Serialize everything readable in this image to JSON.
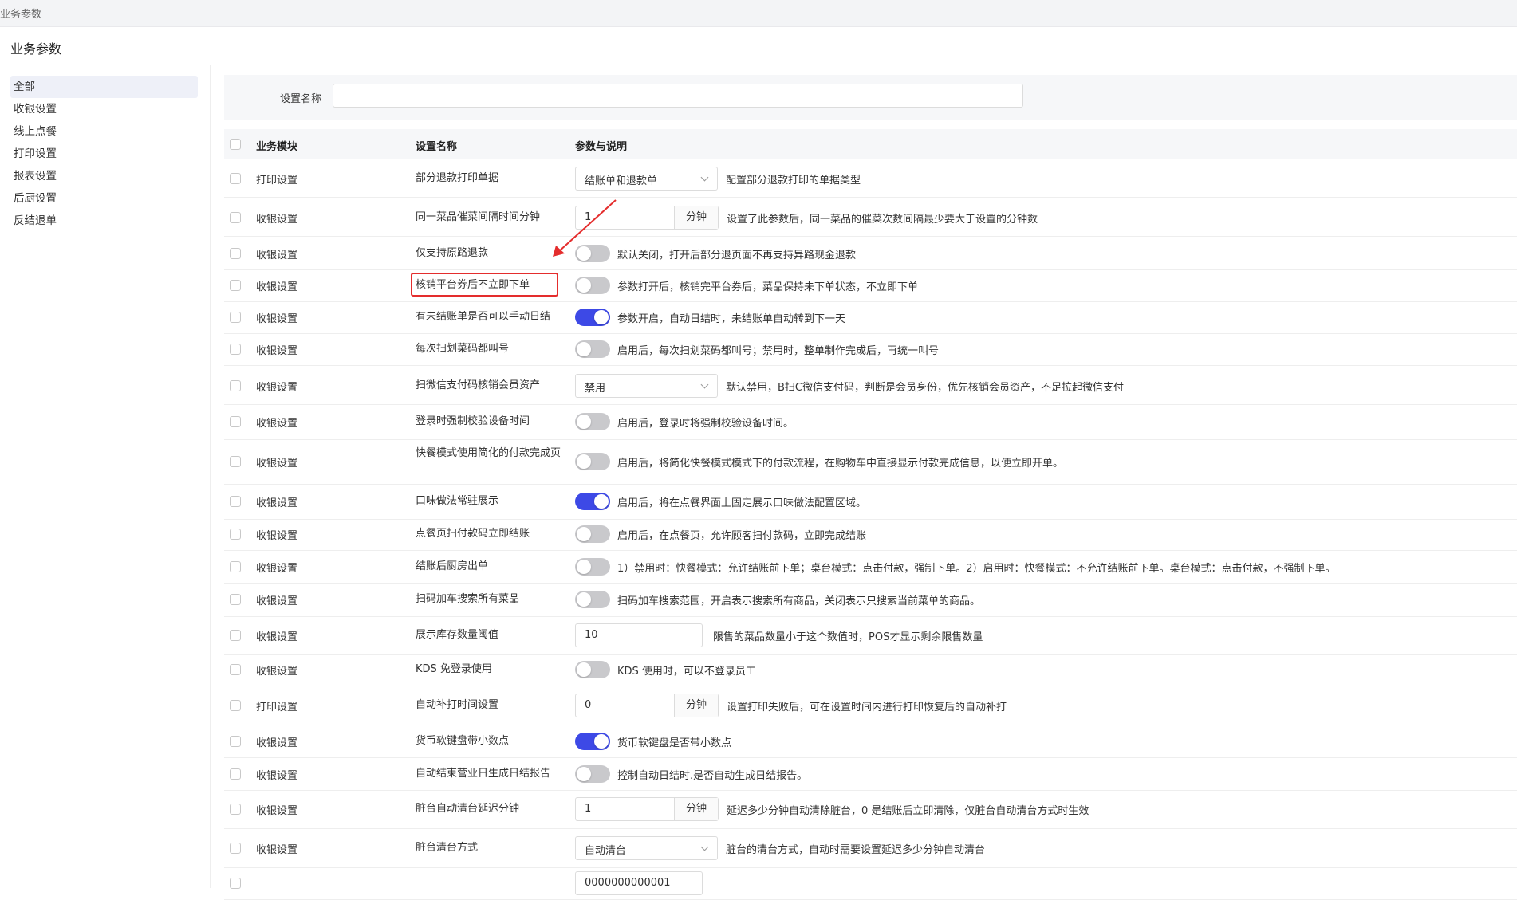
{
  "window": {
    "tab_title": "业务参数"
  },
  "page": {
    "title": "业务参数"
  },
  "sidebar": {
    "items": [
      {
        "label": "全部",
        "active": true
      },
      {
        "label": "收银设置"
      },
      {
        "label": "线上点餐"
      },
      {
        "label": "打印设置"
      },
      {
        "label": "报表设置"
      },
      {
        "label": "后厨设置"
      },
      {
        "label": "反结退单"
      }
    ]
  },
  "filter": {
    "label": "设置名称",
    "value": ""
  },
  "table": {
    "headers": {
      "module": "业务模块",
      "name": "设置名称",
      "param": "参数与说明"
    },
    "rows": [
      {
        "module": "打印设置",
        "name": "部分退款打印单据",
        "control": "select",
        "value": "结账单和退款单",
        "desc": "配置部分退款打印的单据类型"
      },
      {
        "module": "收银设置",
        "name": "同一菜品催菜间隔时间分钟",
        "control": "unit",
        "value": "1",
        "unit": "分钟",
        "desc": "设置了此参数后，同一菜品的催菜次数间隔最少要大于设置的分钟数"
      },
      {
        "module": "收银设置",
        "name": "仅支持原路退款",
        "control": "toggle",
        "on": false,
        "desc": "默认关闭，打开后部分退页面不再支持异路现金退款"
      },
      {
        "module": "收银设置",
        "name": "核销平台券后不立即下单",
        "control": "toggle",
        "on": false,
        "desc": "参数打开后，核销完平台券后，菜品保持未下单状态，不立即下单"
      },
      {
        "module": "收银设置",
        "name": "有未结账单是否可以手动日结",
        "control": "toggle",
        "on": true,
        "desc": "参数开启，自动日结时，未结账单自动转到下一天"
      },
      {
        "module": "收银设置",
        "name": "每次扫划菜码都叫号",
        "control": "toggle",
        "on": false,
        "desc": "启用后，每次扫划菜码都叫号；禁用时，整单制作完成后，再统一叫号"
      },
      {
        "module": "收银设置",
        "name": "扫微信支付码核销会员资产",
        "control": "select",
        "value": "禁用",
        "desc": "默认禁用，B扫C微信支付码，判断是会员身份，优先核销会员资产，不足拉起微信支付"
      },
      {
        "module": "收银设置",
        "name": "登录时强制校验设备时间",
        "control": "toggle",
        "on": false,
        "desc": "启用后，登录时将强制校验设备时间。"
      },
      {
        "module": "收银设置",
        "name": "快餐模式使用简化的付款完成页",
        "control": "toggle",
        "on": false,
        "desc": "启用后，将简化快餐模式模式下的付款流程，在购物车中直接显示付款完成信息，以便立即开单。"
      },
      {
        "module": "收银设置",
        "name": "口味做法常驻展示",
        "control": "toggle",
        "on": true,
        "desc": "启用后，将在点餐界面上固定展示口味做法配置区域。"
      },
      {
        "module": "收银设置",
        "name": "点餐页扫付款码立即结账",
        "control": "toggle",
        "on": false,
        "desc": "启用后，在点餐页，允许顾客扫付款码，立即完成结账"
      },
      {
        "module": "收银设置",
        "name": "结账后厨房出单",
        "control": "toggle",
        "on": false,
        "desc": "1）禁用时：快餐模式：允许结账前下单；桌台模式：点击付款，强制下单。2）启用时：快餐模式：不允许结账前下单。桌台模式：点击付款，不强制下单。"
      },
      {
        "module": "收银设置",
        "name": "扫码加车搜索所有菜品",
        "control": "toggle",
        "on": false,
        "desc": "扫码加车搜索范围，开启表示搜索所有商品，关闭表示只搜索当前菜单的商品。"
      },
      {
        "module": "收银设置",
        "name": "展示库存数量阈值",
        "control": "input",
        "value": "10",
        "desc": "限售的菜品数量小于这个数值时，POS才显示剩余限售数量"
      },
      {
        "module": "收银设置",
        "name": "KDS 免登录使用",
        "control": "toggle",
        "on": false,
        "desc": "KDS 使用时，可以不登录员工"
      },
      {
        "module": "打印设置",
        "name": "自动补打时间设置",
        "control": "unit",
        "value": "0",
        "unit": "分钟",
        "desc": "设置打印失败后，可在设置时间内进行打印恢复后的自动补打"
      },
      {
        "module": "收银设置",
        "name": "货币软键盘带小数点",
        "control": "toggle",
        "on": true,
        "desc": "货币软键盘是否带小数点"
      },
      {
        "module": "收银设置",
        "name": "自动结束营业日生成日结报告",
        "control": "toggle",
        "on": false,
        "desc": "控制自动日结时.是否自动生成日结报告。"
      },
      {
        "module": "收银设置",
        "name": "脏台自动清台延迟分钟",
        "control": "unit",
        "value": "1",
        "unit": "分钟",
        "desc": "延迟多少分钟自动清除脏台，0 是结账后立即清除，仅脏台自动清台方式时生效"
      },
      {
        "module": "收银设置",
        "name": "脏台清台方式",
        "control": "select",
        "value": "自动清台",
        "desc": "脏台的清台方式，自动时需要设置延迟多少分钟自动清台"
      },
      {
        "module": "",
        "name": "",
        "control": "input",
        "value": "0000000000001",
        "desc": ""
      }
    ]
  }
}
